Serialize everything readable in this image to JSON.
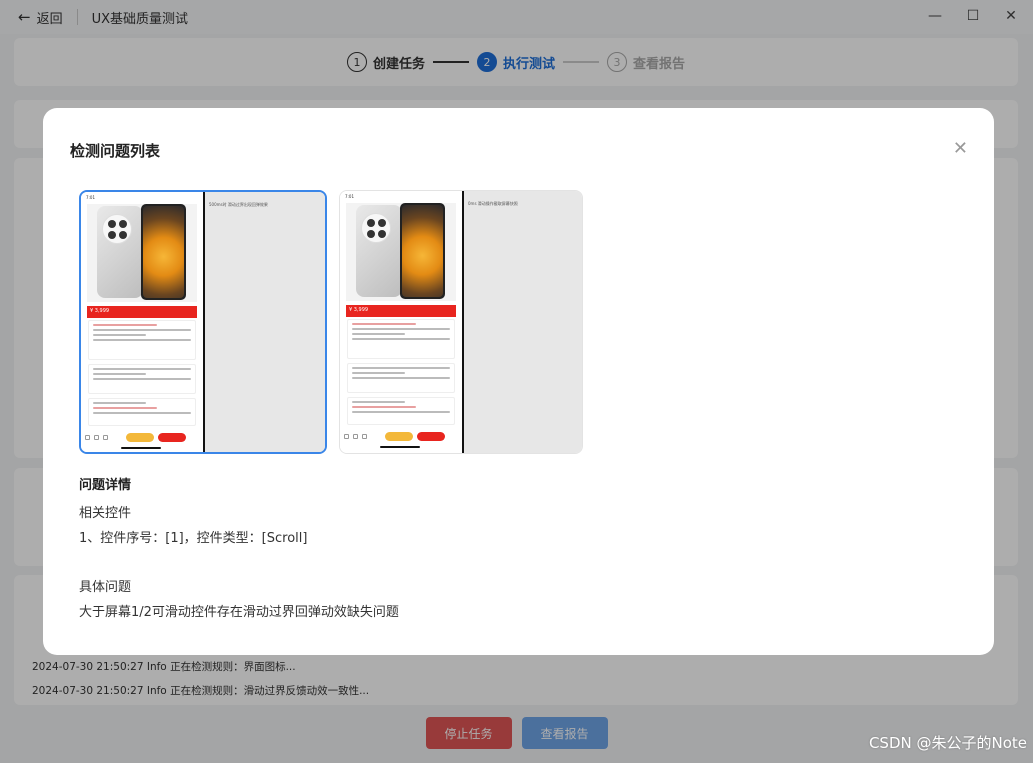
{
  "window": {
    "back_label": "返回",
    "title": "UX基础质量测试"
  },
  "stepper": {
    "steps": [
      {
        "num": "1",
        "label": "创建任务",
        "state": "done"
      },
      {
        "num": "2",
        "label": "执行测试",
        "state": "active"
      },
      {
        "num": "3",
        "label": "查看报告",
        "state": "pending"
      }
    ]
  },
  "log": {
    "lines": [
      "2024-07-30 21:50:27 Info 正在检测规则：界面图标...",
      "2024-07-30 21:50:27 Info 正在检测规则：滑动过界反馈动效一致性..."
    ]
  },
  "actions": {
    "stop_label": "停止任务",
    "view_report_label": "查看报告"
  },
  "modal": {
    "title": "检测问题列表",
    "screenshots": [
      {
        "desc": "500ms时 滑动过界出现回弹效果",
        "selected": true
      },
      {
        "desc": "0ms 滑动操作截取屏幕快照",
        "selected": false
      }
    ],
    "detail_heading": "问题详情",
    "related_controls_label": "相关控件",
    "related_controls_value": "1、控件序号：[1]，控件类型：[Scroll]",
    "issue_label": "具体问题",
    "issue_value": "大于屏幕1/2可滑动控件存在滑动过界回弹动效缺失问题"
  },
  "watermark": "CSDN @朱公子的Note",
  "colors": {
    "accent": "#1e6fd9",
    "stop": "#e05656",
    "view": "#6fa5e8"
  }
}
